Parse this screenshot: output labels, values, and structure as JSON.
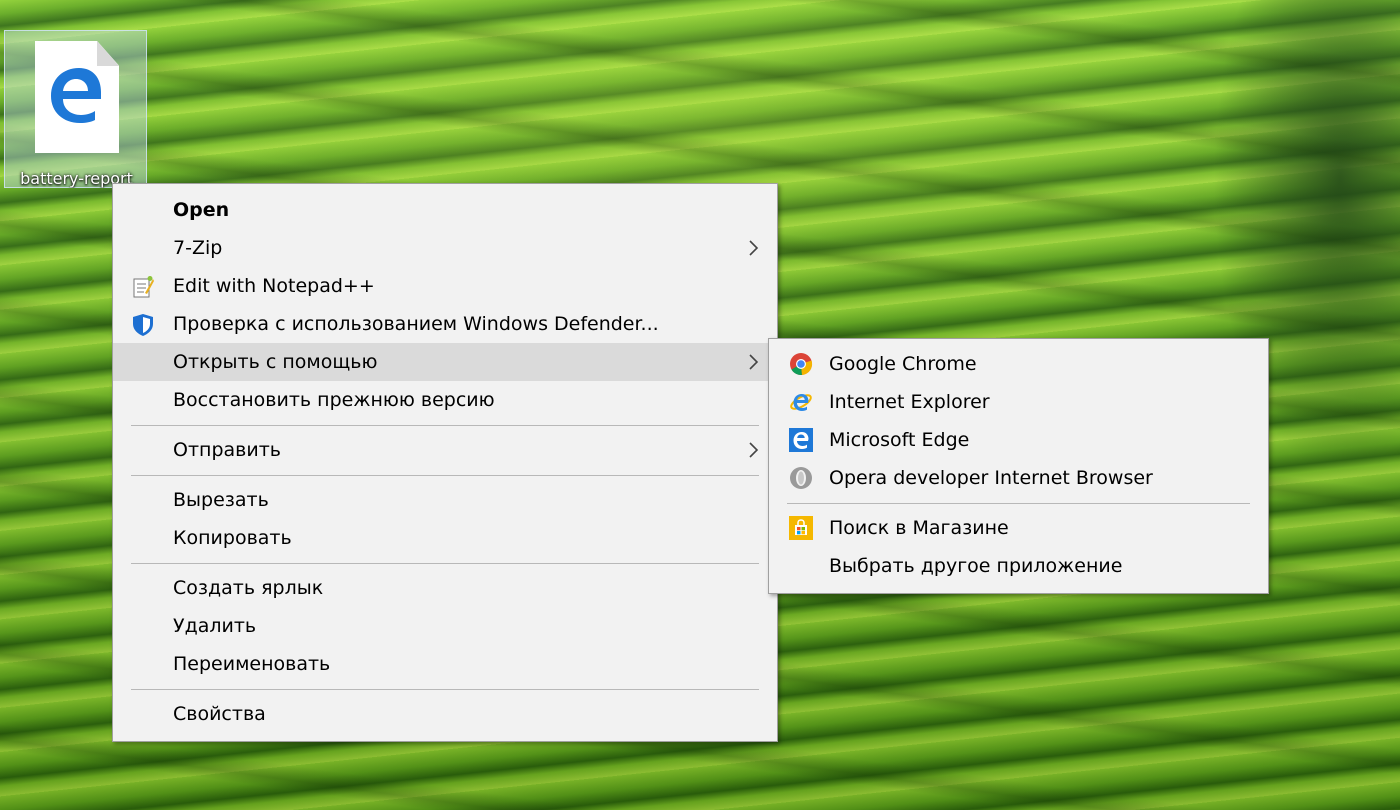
{
  "desktop": {
    "icon": {
      "label": "battery-report",
      "icon": "edge-file-icon",
      "selected": true
    }
  },
  "context_menu": {
    "items": [
      {
        "label": "Open",
        "bold": true
      },
      {
        "label": "7-Zip",
        "submenu": true
      },
      {
        "label": "Edit with Notepad++",
        "icon": "notepad-plus-plus-icon"
      },
      {
        "label": "Проверка с использованием Windows Defender...",
        "icon": "windows-defender-icon"
      },
      {
        "label": "Открыть с помощью",
        "submenu": true,
        "highlighted": true
      },
      {
        "label": "Восстановить прежнюю версию"
      },
      {
        "label": "Отправить",
        "submenu": true
      },
      {
        "label": "Вырезать"
      },
      {
        "label": "Копировать"
      },
      {
        "label": "Создать ярлык"
      },
      {
        "label": "Удалить"
      },
      {
        "label": "Переименовать"
      },
      {
        "label": "Свойства"
      }
    ]
  },
  "open_with_submenu": {
    "items": [
      {
        "label": "Google Chrome",
        "icon": "chrome-icon"
      },
      {
        "label": "Internet Explorer",
        "icon": "internet-explorer-icon"
      },
      {
        "label": "Microsoft Edge",
        "icon": "edge-icon"
      },
      {
        "label": "Opera developer Internet Browser",
        "icon": "opera-icon"
      },
      {
        "label": "Поиск в Магазине",
        "icon": "store-icon"
      },
      {
        "label": "Выбрать другое приложение"
      }
    ]
  },
  "colors": {
    "menu_background": "#f2f2f2",
    "menu_highlight": "#dadada",
    "edge_blue": "#1e78d7"
  }
}
